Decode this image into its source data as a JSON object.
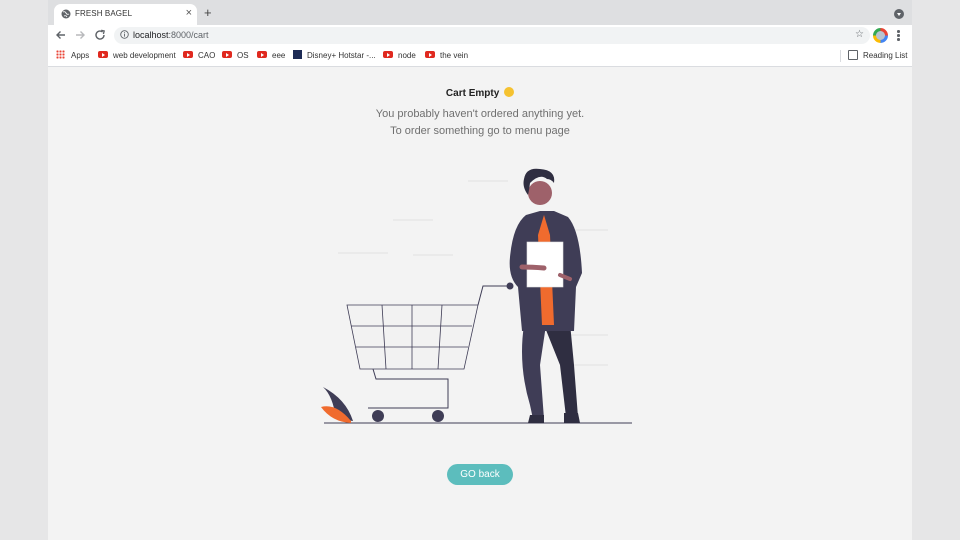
{
  "tab": {
    "title": "FRESH BAGEL",
    "close_glyph": "×",
    "new_tab_glyph": "+"
  },
  "toolbar": {
    "url_host": "localhost",
    "url_path": ":8000/cart",
    "star_glyph": "☆"
  },
  "bookmarks": {
    "apps": "Apps",
    "items": [
      "web development",
      "CAO",
      "OS",
      "eee",
      "Disney+ Hotstar -...",
      "node",
      "the vein"
    ],
    "reading_list": "Reading List"
  },
  "page": {
    "heading": "Cart Empty",
    "line1": "You probably haven't ordered anything yet.",
    "line2": "To order something go to menu page",
    "button": "GO back"
  },
  "colors": {
    "accent": "#5cbdbd",
    "orange": "#f06b2e",
    "dark": "#3f3d56",
    "skin": "#9e616a"
  },
  "icons": [
    "globe-icon",
    "close-icon",
    "plus-icon",
    "back-arrow-icon",
    "forward-arrow-icon",
    "reload-icon",
    "info-icon",
    "star-icon",
    "profile-avatar",
    "kebab-menu-icon",
    "apps-grid-icon",
    "youtube-icon",
    "hotstar-icon",
    "reading-list-icon",
    "emoji-icon"
  ]
}
